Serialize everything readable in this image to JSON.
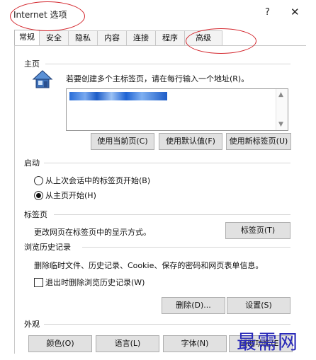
{
  "window": {
    "title": "Internet 选项",
    "help": "?",
    "close": "✕"
  },
  "tabs": [
    {
      "label": "常规"
    },
    {
      "label": "安全"
    },
    {
      "label": "隐私"
    },
    {
      "label": "内容"
    },
    {
      "label": "连接"
    },
    {
      "label": "程序"
    },
    {
      "label": "高级"
    }
  ],
  "homepage": {
    "section": "主页",
    "description": "若要创建多个主标签页，请在每行输入一个地址(R)。",
    "icon": "house-icon",
    "buttons": {
      "use_current": "使用当前页(C)",
      "use_default": "使用默认值(F)",
      "use_new_tab": "使用新标签页(U)"
    }
  },
  "startup": {
    "section": "启动",
    "option_last_session": "从上次会话中的标签页开始(B)",
    "option_home": "从主页开始(H)",
    "selected": "option_home"
  },
  "tabs_section": {
    "section": "标签页",
    "description": "更改网页在标签页中的显示方式。",
    "button": "标签页(T)"
  },
  "history": {
    "section": "浏览历史记录",
    "description": "删除临时文件、历史记录、Cookie、保存的密码和网页表单信息。",
    "checkbox": "退出时删除浏览历史记录(W)",
    "checked": false,
    "delete_button": "删除(D)...",
    "settings_button": "设置(S)"
  },
  "appearance": {
    "section": "外观",
    "colors": "颜色(O)",
    "languages": "语言(L)",
    "fonts": "字体(N)",
    "accessibility": "辅助功能(E)"
  },
  "watermark": "最需网",
  "colors": {
    "annotation": "#d3242b",
    "watermark": "#2a2ab8",
    "address_highlight": "#2a6ed8"
  }
}
